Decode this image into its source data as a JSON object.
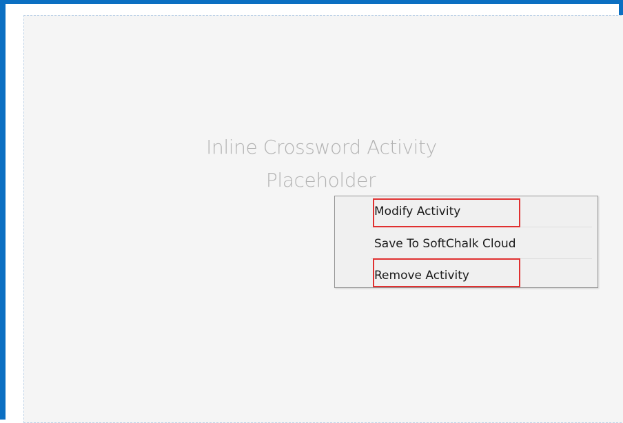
{
  "placeholder": {
    "line1": "Inline Crossword Activity",
    "line2": "Placeholder"
  },
  "context_menu": {
    "items": [
      {
        "label": "Modify Activity",
        "highlighted": true
      },
      {
        "label": "Save To SoftChalk Cloud",
        "highlighted": false
      },
      {
        "label": "Remove Activity",
        "highlighted": true
      }
    ]
  },
  "colors": {
    "frame_border": "#0b6fc2",
    "canvas_background": "#f5f5f5",
    "placeholder_text": "#b3b3b3",
    "menu_background": "#f0f0f0",
    "highlight_box": "#e03030"
  }
}
